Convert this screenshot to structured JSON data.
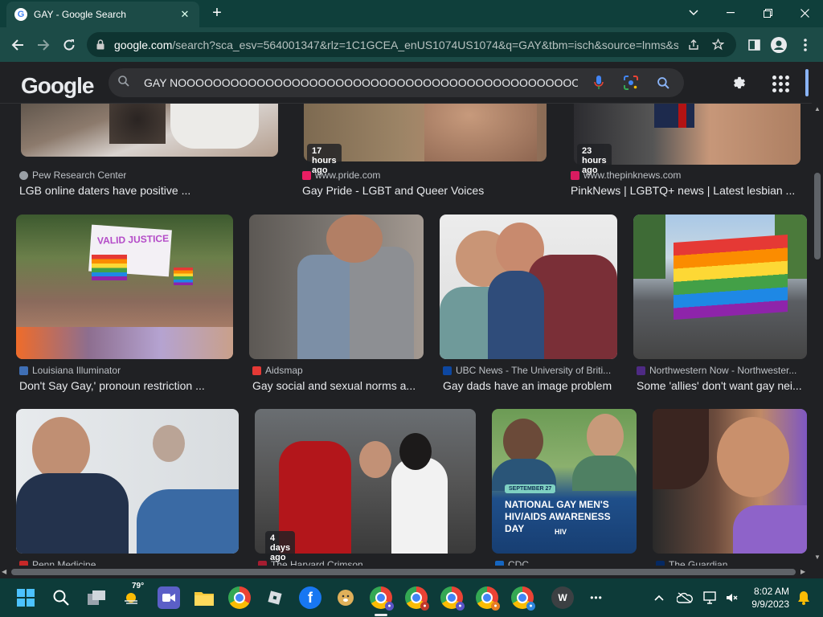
{
  "browser": {
    "tab_title": "GAY - Google Search",
    "tab_close": "✕",
    "new_tab": "+",
    "url_host": "google.com",
    "url_rest": "/search?sca_esv=564001347&rlz=1C1GCEA_enUS1074US1074&q=GAY&tbm=isch&source=lnms&s..."
  },
  "google": {
    "logo": "Google",
    "search_value": "GAY NOOOOOOOOOOOOOOOOOOOOOOOOOOOOOOOOOOOOOOOOOOOOOOOO"
  },
  "results": {
    "row1": [
      {
        "source": "Pew Research Center",
        "title": "LGB online daters have positive ...",
        "badge": ""
      },
      {
        "source": "www.pride.com",
        "title": "Gay Pride - LGBT and Queer Voices",
        "badge": "17 hours ago"
      },
      {
        "source": "www.thepinknews.com",
        "title": "PinkNews | LGBTQ+ news | Latest lesbian ...",
        "badge": "23 hours ago"
      }
    ],
    "row2": [
      {
        "source": "Louisiana Illuminator",
        "title": "Don't Say Gay,' pronoun restriction ...",
        "badge": ""
      },
      {
        "source": "Aidsmap",
        "title": "Gay social and sexual norms a...",
        "badge": ""
      },
      {
        "source": "UBC News - The University of Briti...",
        "title": "Gay dads have an image problem",
        "badge": ""
      },
      {
        "source": "Northwestern Now - Northwester...",
        "title": "Some 'allies' don't want gay nei...",
        "badge": ""
      }
    ],
    "row3": [
      {
        "source": "Penn Medicine",
        "badge": ""
      },
      {
        "source": "The Harvard Crimson",
        "badge": "4 days ago"
      },
      {
        "source": "CDC",
        "badge": "",
        "poster_date": "SEPTEMBER 27",
        "poster_text": "NATIONAL GAY MEN'S HIV/AIDS AWARENESS DAY",
        "poster_logo": "HIV"
      },
      {
        "source": "The Guardian",
        "badge": ""
      }
    ],
    "sign_text": "VALID JUSTICE"
  },
  "taskbar": {
    "weather": "79°",
    "clock_time": "8:02 AM",
    "clock_date": "9/9/2023",
    "w_app": "W",
    "more": "•••"
  }
}
